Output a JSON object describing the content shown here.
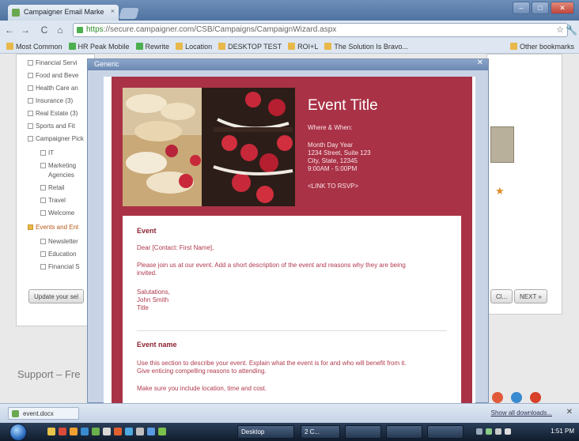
{
  "browser": {
    "tab_title": "Campaigner Email Marke",
    "tab_close": "×",
    "url_https": "https",
    "url_rest": "://secure.campaigner.com/CSB/Campaigns/CampaignWizard.aspx",
    "window_buttons": {
      "minimize": "–",
      "maximize": "□",
      "close": "✕"
    },
    "nav": {
      "back": "←",
      "forward": "→",
      "reload": "C",
      "home": "⌂"
    },
    "star_icon": "☆",
    "wrench_icon": "🔧"
  },
  "bookmarks": [
    {
      "label": "Most Common",
      "icon": "folder"
    },
    {
      "label": "HR Peak Mobile",
      "icon": "green"
    },
    {
      "label": "Rewrite",
      "icon": "green"
    },
    {
      "label": "Location",
      "icon": "folder"
    },
    {
      "label": "DESKTOP TEST",
      "icon": "folder"
    },
    {
      "label": "ROI+L",
      "icon": "folder"
    },
    {
      "label": "The Solution Is Bravo...",
      "icon": "folder"
    },
    {
      "label": "Other bookmarks",
      "icon": "folder"
    }
  ],
  "background": {
    "tree_items": [
      {
        "label": "Financial Servi",
        "type": "item"
      },
      {
        "label": "Food and Beve",
        "type": "item"
      },
      {
        "label": "Health Care an",
        "type": "item"
      },
      {
        "label": "Insurance (3)",
        "type": "item"
      },
      {
        "label": "Real Estate (3)",
        "type": "item"
      },
      {
        "label": "Sports and Fit",
        "type": "item"
      },
      {
        "label": "Campaigner Pick",
        "type": "item"
      },
      {
        "label": "IT",
        "type": "sub"
      },
      {
        "label": "Marketing",
        "type": "sub"
      },
      {
        "label": "Agencies",
        "type": "subcont"
      },
      {
        "label": "Retail",
        "type": "sub"
      },
      {
        "label": "Travel",
        "type": "sub"
      },
      {
        "label": "Welcome",
        "type": "sub"
      },
      {
        "label": "Events and Ent",
        "type": "folder"
      },
      {
        "label": "Newsletter",
        "type": "sub"
      },
      {
        "label": "Education",
        "type": "sub"
      },
      {
        "label": "Financial S",
        "type": "sub"
      }
    ],
    "left_button": "Update your sel",
    "right_button_1": "Cl...",
    "right_button_2": "NEXT »",
    "support_text": "Support – Fre"
  },
  "dialog": {
    "title": "Generic",
    "close_icon": "✕"
  },
  "email": {
    "hero": {
      "title": "Event Title",
      "where_when": "Where & When:",
      "address_lines": [
        "Month Day Year",
        "1234 Street, Suite 123",
        "City, State, 12345",
        "9:00AM - 5:00PM"
      ],
      "rsvp_link": "<LINK TO RSVP>"
    },
    "section1": {
      "heading": "Event",
      "greeting": "Dear [Contact: First Name],",
      "body_lines": [
        "Please join us at our event. Add a short description of the event and reasons why they are being",
        "invited."
      ],
      "signoff": [
        "Salutations,",
        "John Smith",
        "Title"
      ]
    },
    "section2": {
      "heading": "Event name",
      "body_lines": [
        "Use this section to describe your event. Explain what the event is for and who will benefit from it.",
        "Give enticing compelling reasons to attending."
      ],
      "extra_line": "Make sure you include location, time and cost."
    }
  },
  "statusbar": {
    "download_label": "event.docx",
    "show_all": "Show all downloads...",
    "close_icon": "✕"
  },
  "taskbar": {
    "buttons": [
      {
        "label": "Desktop"
      },
      {
        "label": "2 C..."
      },
      {
        "label": ""
      },
      {
        "label": ""
      },
      {
        "label": ""
      }
    ],
    "clock": "1:51 PM"
  }
}
